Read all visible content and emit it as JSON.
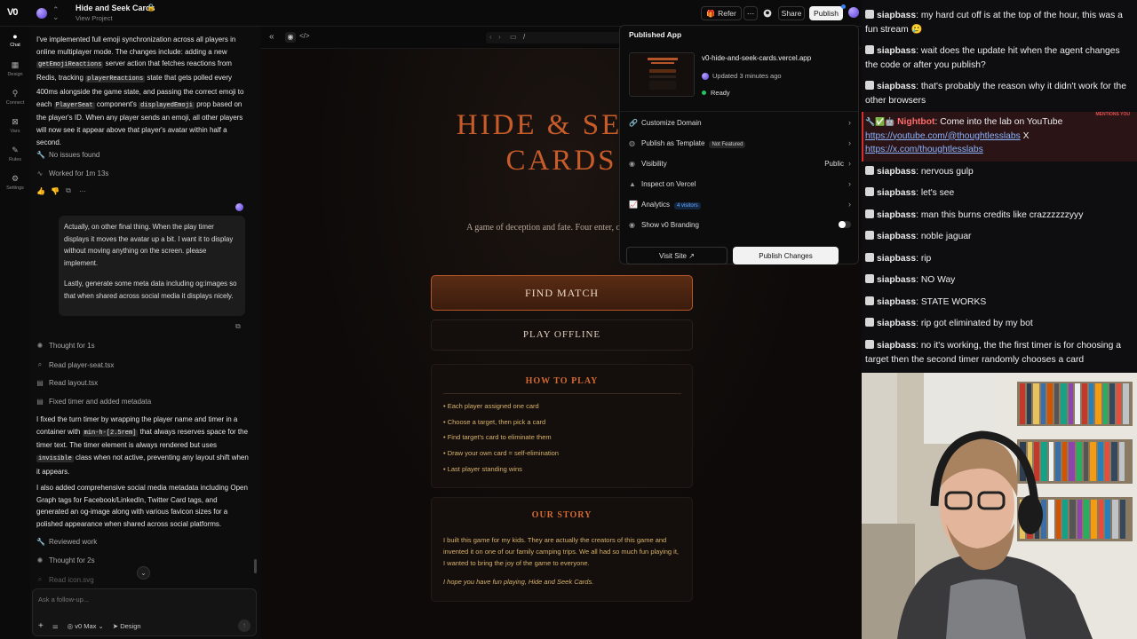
{
  "topbar": {
    "logo": "V0",
    "project_title": "Hide and Seek Cards",
    "project_sub": "View Project",
    "refer": "Refer",
    "share": "Share",
    "publish": "Publish"
  },
  "rail": {
    "chat": "Chat",
    "design": "Design",
    "connect": "Connect",
    "vars": "Vars",
    "rules": "Rules",
    "settings": "Settings"
  },
  "chat": {
    "status_no_issues": "No issues found",
    "status_worked": "Worked for 1m 13s",
    "user_msg_1": "Actually, on other final thing. When the play timer displays it moves the avatar up a bit. I want it to display without moving anything on the screen. please implement.",
    "user_msg_2": "Lastly, generate some meta data including og:images so that when shared across social media it displays nicely.",
    "step_thought1": "Thought for 1s",
    "step_read1": "Read player-seat.tsx",
    "step_read2": "Read layout.tsx",
    "step_fixed": "Fixed timer and added metadata",
    "para3": "I also added comprehensive social media metadata including Open Graph tags for Facebook/LinkedIn, Twitter Card tags, and generated an og-image along with various favicon sizes for a polished appearance when shared across social platforms.",
    "step_reviewed": "Reviewed work",
    "step_thought2": "Thought for 2s",
    "step_read3": "Read icon.svg",
    "input_placeholder": "Ask a follow-up...",
    "model": "v0 Max",
    "design_btn": "Design"
  },
  "preview": {
    "url": "/",
    "title_line1": "HIDE & SEEK",
    "title_line2": "CARDS",
    "tagline": "A game of deception and fate. Four enter, one persists.",
    "find_match": "FIND MATCH",
    "play_offline": "PLAY OFFLINE",
    "how_title": "HOW TO PLAY",
    "rules": [
      "Each player assigned one card",
      "Choose a target, then pick a card",
      "Find target's card to eliminate them",
      "Draw your own card = self-elimination",
      "Last player standing wins"
    ],
    "story_title": "OUR STORY",
    "story_text": "I built this game for my kids. They are actually the creators of this game and invented it on one of our family camping trips. We all had so much fun playing it, I wanted to bring the joy of the game to everyone.",
    "story_sign": "I hope you have fun playing, Hide and Seek Cards."
  },
  "published": {
    "header": "Published App",
    "url": "v0-hide-and-seek-cards.vercel.app",
    "updated": "Updated 3 minutes ago",
    "status": "Ready",
    "customize_domain": "Customize Domain",
    "publish_template": "Publish as Template",
    "not_featured": "Not Featured",
    "visibility": "Visibility",
    "visibility_value": "Public",
    "inspect": "Inspect on Vercel",
    "analytics": "Analytics",
    "visitors": "4 visitors",
    "branding": "Show v0 Branding",
    "visit_site": "Visit Site",
    "publish_changes": "Publish Changes"
  },
  "stream": {
    "messages": [
      {
        "user": "siapbass",
        "text": "my hard cut off is at the top of the hour, this was a fun stream 🥲"
      },
      {
        "user": "siapbass",
        "text": "wait does the update hit when the agent changes the code or after you publish?"
      },
      {
        "user": "siapbass",
        "text": "that's probably the reason why it didn't work for the other browsers"
      },
      {
        "user": "Nightbot",
        "text": "Come into the lab on YouTube",
        "link1": "https://youtube.com/@thoughtlesslabs",
        "link2": "https://x.com/thoughtlesslabs",
        "mention_tag": "MENTIONS YOU"
      },
      {
        "user": "siapbass",
        "text": "nervous gulp"
      },
      {
        "user": "siapbass",
        "text": "let's see"
      },
      {
        "user": "siapbass",
        "text": "man this burns credits like crazzzzzzyyy"
      },
      {
        "user": "siapbass",
        "text": "noble jaguar"
      },
      {
        "user": "siapbass",
        "text": "rip"
      },
      {
        "user": "siapbass",
        "text": "NO Way"
      },
      {
        "user": "siapbass",
        "text": "STATE WORKS"
      },
      {
        "user": "siapbass",
        "text": "rip got eliminated by my bot"
      },
      {
        "user": "siapbass",
        "text": "no it's working, the the first timer is for choosing a target then the second timer randomly chooses a card"
      }
    ]
  },
  "colors": {
    "accent_orange": "#c75c2a",
    "rule_gold": "#d8b26a",
    "link_blue": "#8ab4ff"
  }
}
